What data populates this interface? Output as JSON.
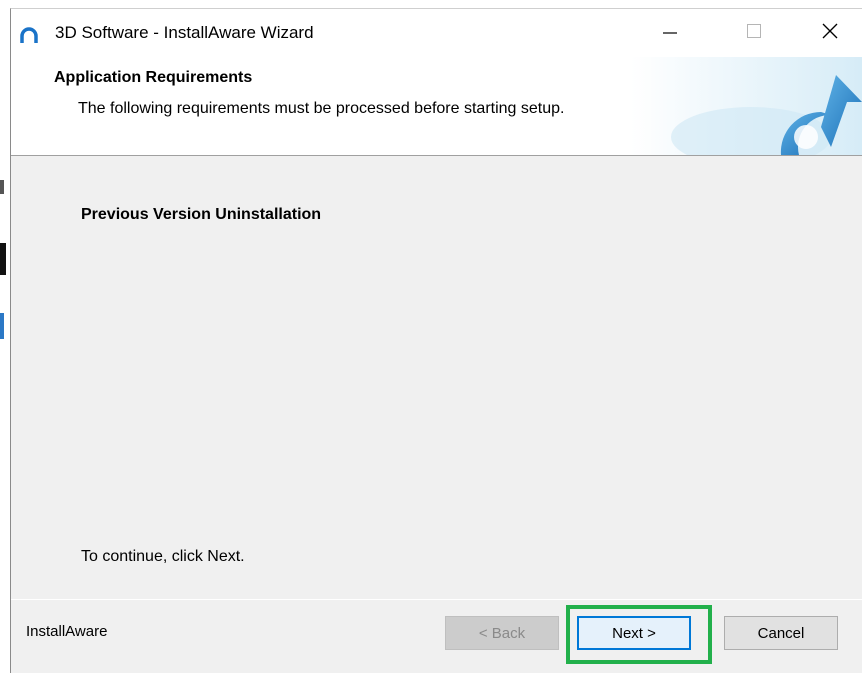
{
  "window": {
    "title": "3D Software - InstallAware Wizard",
    "icon": "installaware-arc-icon"
  },
  "titlebar": {
    "minimize_icon": "minimize-icon",
    "maximize_icon": "maximize-icon",
    "close_icon": "close-icon"
  },
  "header": {
    "title": "Application Requirements",
    "subtitle": "The following requirements must be processed before starting setup."
  },
  "body": {
    "section_title": "Previous Version Uninstallation",
    "instruction": "To continue, click Next."
  },
  "footer": {
    "brand": "InstallAware",
    "back_label": "< Back",
    "next_label": "Next >",
    "cancel_label": "Cancel"
  },
  "colors": {
    "accent": "#0078d7",
    "highlight": "#22b04b",
    "dialog_bg": "#f0f0f0"
  }
}
